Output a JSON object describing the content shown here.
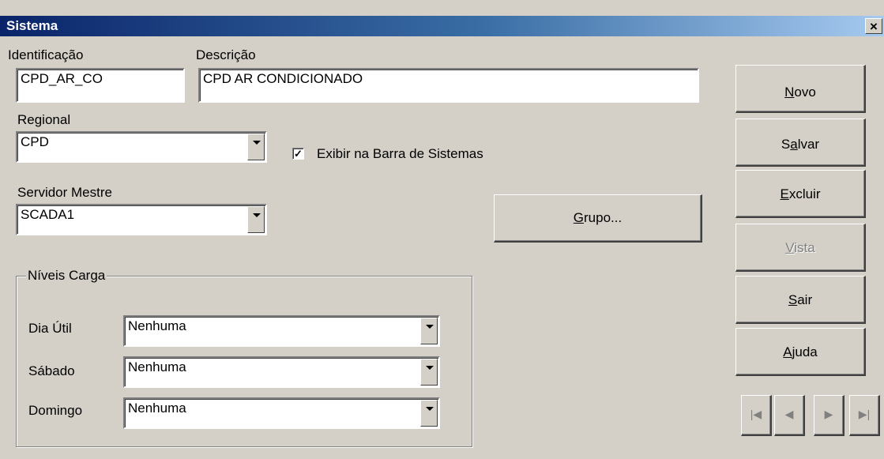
{
  "window": {
    "title": "Sistema",
    "close_glyph": "×"
  },
  "form": {
    "identificacao_label": "Identificação",
    "identificacao_value": "CPD_AR_CO",
    "descricao_label": "Descrição",
    "descricao_value": "CPD AR CONDICIONADO",
    "regional_label": "Regional",
    "regional_value": "CPD",
    "exibir_label": "Exibir na Barra de Sistemas",
    "exibir_checked": true,
    "exibir_check_glyph": "✓",
    "servidor_label": "Servidor Mestre",
    "servidor_value": "SCADA1",
    "grupo_button": {
      "pre": "",
      "u": "G",
      "post": "rupo..."
    }
  },
  "niveis_carga": {
    "title": "Níveis Carga",
    "rows": [
      {
        "label": "Dia Útil",
        "value": "Nenhuma"
      },
      {
        "label": "Sábado",
        "value": "Nenhuma"
      },
      {
        "label": "Domingo",
        "value": "Nenhuma"
      }
    ]
  },
  "actions": {
    "novo": {
      "pre": "",
      "u": "N",
      "post": "ovo"
    },
    "salvar": {
      "pre": "S",
      "u": "a",
      "post": "lvar"
    },
    "excluir": {
      "pre": "",
      "u": "E",
      "post": "xcluir"
    },
    "vista": {
      "pre": "",
      "u": "V",
      "post": "ista",
      "disabled": true
    },
    "sair": {
      "pre": "",
      "u": "S",
      "post": "air"
    },
    "ajuda": {
      "pre": "",
      "u": "A",
      "post": "juda"
    }
  },
  "navigation": {
    "first_icon": "first-record-icon",
    "prev_icon": "previous-record-icon",
    "next_icon": "next-record-icon",
    "last_icon": "last-record-icon",
    "first_glyph": "|◀",
    "prev_glyph": "◀",
    "next_glyph": "▶",
    "last_glyph": "▶|",
    "disabled": true
  },
  "colors": {
    "titlebar_start": "#0a246a",
    "titlebar_end": "#a6caf0",
    "face": "#d4d0c8",
    "disabled_text": "#808080"
  }
}
